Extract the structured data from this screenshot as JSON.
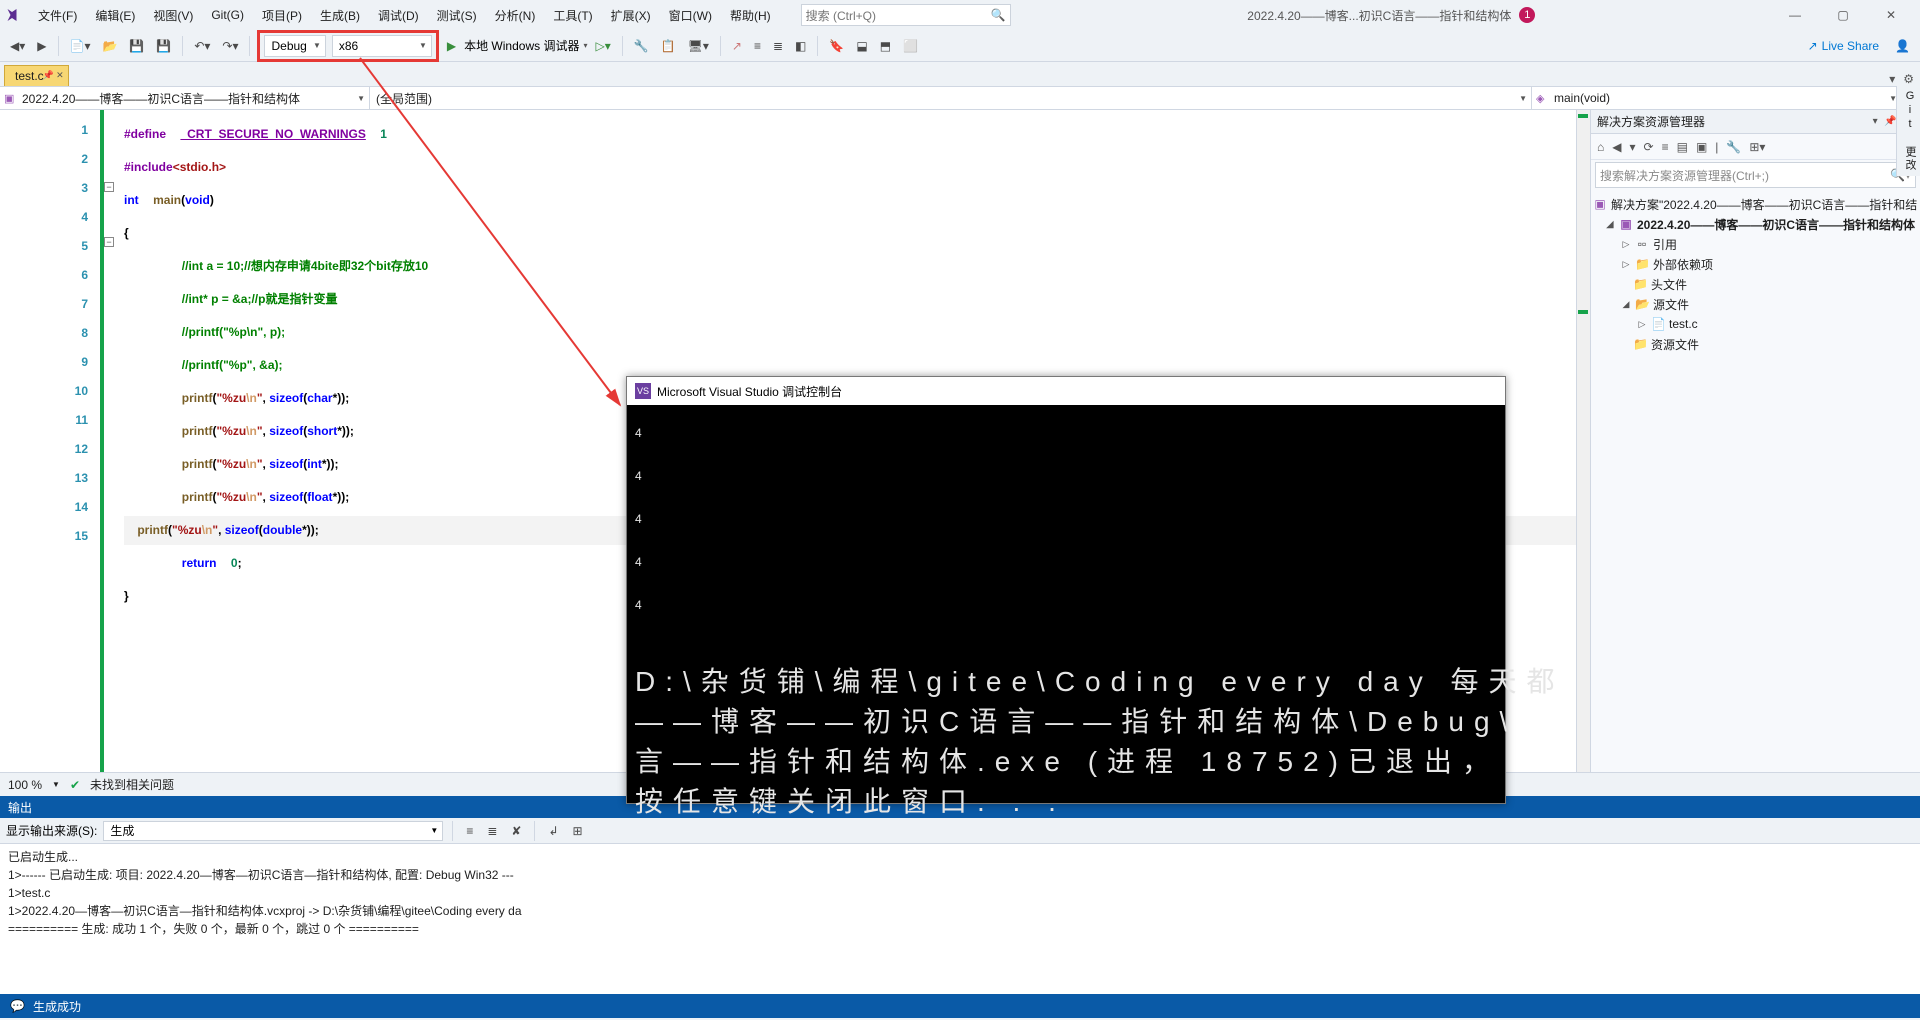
{
  "menu": {
    "file": "文件(F)",
    "edit": "编辑(E)",
    "view": "视图(V)",
    "git": "Git(G)",
    "project": "项目(P)",
    "build": "生成(B)",
    "debug": "调试(D)",
    "test": "测试(S)",
    "analyze": "分析(N)",
    "tools": "工具(T)",
    "extensions": "扩展(X)",
    "window": "窗口(W)",
    "help": "帮助(H)"
  },
  "search": {
    "placeholder": "搜索 (Ctrl+Q)"
  },
  "title": "2022.4.20——博客...初识C语言——指针和结构体",
  "badge": "1",
  "toolbar": {
    "config": "Debug",
    "platform": "x86",
    "debuggerLabel": "本地 Windows 调试器",
    "liveShare": "Live Share"
  },
  "tab": {
    "name": "test.c"
  },
  "nav": {
    "project": "2022.4.20——博客——初识C语言——指针和结构体",
    "scope": "(全局范围)",
    "member": "main(void)"
  },
  "lines": [
    "1",
    "2",
    "3",
    "4",
    "5",
    "6",
    "7",
    "8",
    "9",
    "10",
    "11",
    "12",
    "13",
    "14",
    "15"
  ],
  "code": {
    "l1a": "#define",
    "l1b": "_CRT_SECURE_NO_WARNINGS",
    "l1c": "1",
    "l2a": "#include",
    "l2b": "<stdio.h>",
    "l3a": "int",
    "l3b": "main",
    "l3c": "(",
    "l3d": "void",
    "l3e": ")",
    "l4": "{",
    "l5": "//int a = 10;//想内存申请4bite即32个bit存放10",
    "l6": "//int* p = &a;//p就是指针变量",
    "l7": "//printf(\"%p\\n\", p);",
    "l8": "//printf(\"%p\", &a);",
    "l9a": "printf",
    "l9b": "(",
    "l9c": "\"%zu",
    "l9d": "\\n",
    "l9e": "\"",
    "l9f": ", ",
    "l9g": "sizeof",
    "l9h": "(",
    "l9i": "char",
    "l9j": "*));",
    "l10i": "short",
    "l11i": "int",
    "l12i": "float",
    "l13i": "double",
    "l14a": "return",
    "l14b": "0",
    "l14c": ";",
    "l15": "}"
  },
  "zoom": {
    "pct": "100 %",
    "issues": "未找到相关问题"
  },
  "output": {
    "title": "输出",
    "sourceLabel": "显示输出来源(S):",
    "source": "生成",
    "lines": [
      "已启动生成...",
      "1>------ 已启动生成: 项目: 2022.4.20—博客—初识C语言—指针和结构体, 配置: Debug Win32 ---",
      "1>test.c",
      "1>2022.4.20—博客—初识C语言—指针和结构体.vcxproj -> D:\\杂货铺\\编程\\gitee\\Coding every da",
      "========== 生成: 成功 1 个，失败 0 个，最新 0 个，跳过 0 个 =========="
    ]
  },
  "status": {
    "text": "生成成功"
  },
  "solution": {
    "panel": "解决方案资源管理器",
    "search": "搜索解决方案资源管理器(Ctrl+;)",
    "root": "解决方案\"2022.4.20——博客——初识C语言——指针和结",
    "proj": "2022.4.20——博客——初识C语言——指针和结构体",
    "refs": "引用",
    "ext": "外部依赖项",
    "hdr": "头文件",
    "src": "源文件",
    "file": "test.c",
    "res": "资源文件"
  },
  "vtab": "Git 更改",
  "console": {
    "title": "Microsoft Visual Studio 调试控制台",
    "out": [
      "4",
      "4",
      "4",
      "4",
      "4"
    ],
    "path1": "D:\\杂货铺\\编程\\gitee\\Coding every day 每天都",
    "path2": "——博客——初识C语言——指针和结构体\\Debug\\",
    "path3": "言——指针和结构体.exe (进程 18752)已退出，",
    "path4": "按任意键关闭此窗口. . ."
  }
}
